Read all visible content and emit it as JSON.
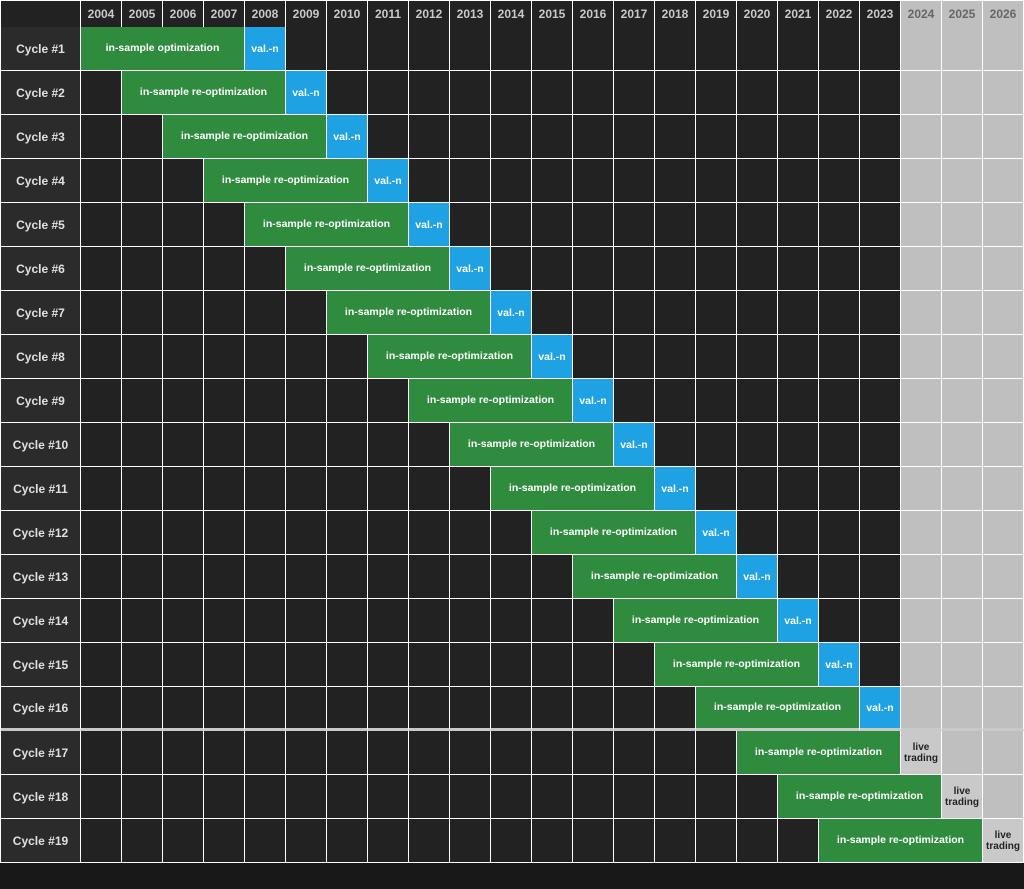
{
  "years": [
    "2004",
    "2005",
    "2006",
    "2007",
    "2008",
    "2009",
    "2010",
    "2011",
    "2012",
    "2013",
    "2014",
    "2015",
    "2016",
    "2017",
    "2018",
    "2019",
    "2020",
    "2021",
    "2022",
    "2023",
    "2024",
    "2025",
    "2026"
  ],
  "future_years_start_index": 20,
  "labels": {
    "opt_first": "in-sample optimization",
    "opt_re": "in-sample re-optimization",
    "val": "val.-n",
    "live": "live trading"
  },
  "rows": [
    {
      "name": "Cycle #1",
      "opt_start": 0,
      "opt_end": 4,
      "val": 4,
      "first": true
    },
    {
      "name": "Cycle #2",
      "opt_start": 1,
      "opt_end": 5,
      "val": 5
    },
    {
      "name": "Cycle #3",
      "opt_start": 2,
      "opt_end": 6,
      "val": 6
    },
    {
      "name": "Cycle #4",
      "opt_start": 3,
      "opt_end": 7,
      "val": 7
    },
    {
      "name": "Cycle #5",
      "opt_start": 4,
      "opt_end": 8,
      "val": 8
    },
    {
      "name": "Cycle #6",
      "opt_start": 5,
      "opt_end": 9,
      "val": 9
    },
    {
      "name": "Cycle #7",
      "opt_start": 6,
      "opt_end": 10,
      "val": 10
    },
    {
      "name": "Cycle #8",
      "opt_start": 7,
      "opt_end": 11,
      "val": 11
    },
    {
      "name": "Cycle #9",
      "opt_start": 8,
      "opt_end": 12,
      "val": 12
    },
    {
      "name": "Cycle #10",
      "opt_start": 9,
      "opt_end": 13,
      "val": 13
    },
    {
      "name": "Cycle #11",
      "opt_start": 10,
      "opt_end": 14,
      "val": 14
    },
    {
      "name": "Cycle #12",
      "opt_start": 11,
      "opt_end": 15,
      "val": 15
    },
    {
      "name": "Cycle #13",
      "opt_start": 12,
      "opt_end": 16,
      "val": 16
    },
    {
      "name": "Cycle #14",
      "opt_start": 13,
      "opt_end": 17,
      "val": 17
    },
    {
      "name": "Cycle #15",
      "opt_start": 14,
      "opt_end": 18,
      "val": 18
    },
    {
      "name": "Cycle #16",
      "opt_start": 15,
      "opt_end": 19,
      "val": 19,
      "last_val": true
    },
    {
      "name": "Cycle #17",
      "opt_start": 16,
      "opt_end": 20,
      "live": 20
    },
    {
      "name": "Cycle #18",
      "opt_start": 17,
      "opt_end": 21,
      "live": 21
    },
    {
      "name": "Cycle #19",
      "opt_start": 18,
      "opt_end": 22,
      "live": 22
    }
  ],
  "chart_data": {
    "type": "table",
    "description": "Walk-forward optimization schedule. Each cycle has a 4-year in-sample window followed by a 1-year validation (val.-n) period. Cycle 1 optimizes 2004-2007 and validates 2008, each subsequent cycle shifts by one year. Cycles 17-19 run into future years 2024-2026 and their final slot is labeled 'live trading' instead of validation.",
    "years": [
      "2004",
      "2005",
      "2006",
      "2007",
      "2008",
      "2009",
      "2010",
      "2011",
      "2012",
      "2013",
      "2014",
      "2015",
      "2016",
      "2017",
      "2018",
      "2019",
      "2020",
      "2021",
      "2022",
      "2023",
      "2024",
      "2025",
      "2026"
    ],
    "cycles": [
      {
        "cycle": 1,
        "in_sample": [
          "2004",
          "2005",
          "2006",
          "2007"
        ],
        "validation": "2008"
      },
      {
        "cycle": 2,
        "in_sample": [
          "2005",
          "2006",
          "2007",
          "2008"
        ],
        "validation": "2009"
      },
      {
        "cycle": 3,
        "in_sample": [
          "2006",
          "2007",
          "2008",
          "2009"
        ],
        "validation": "2010"
      },
      {
        "cycle": 4,
        "in_sample": [
          "2007",
          "2008",
          "2009",
          "2010"
        ],
        "validation": "2011"
      },
      {
        "cycle": 5,
        "in_sample": [
          "2008",
          "2009",
          "2010",
          "2011"
        ],
        "validation": "2012"
      },
      {
        "cycle": 6,
        "in_sample": [
          "2009",
          "2010",
          "2011",
          "2012"
        ],
        "validation": "2013"
      },
      {
        "cycle": 7,
        "in_sample": [
          "2010",
          "2011",
          "2012",
          "2013"
        ],
        "validation": "2014"
      },
      {
        "cycle": 8,
        "in_sample": [
          "2011",
          "2012",
          "2013",
          "2014"
        ],
        "validation": "2015"
      },
      {
        "cycle": 9,
        "in_sample": [
          "2012",
          "2013",
          "2014",
          "2015"
        ],
        "validation": "2016"
      },
      {
        "cycle": 10,
        "in_sample": [
          "2013",
          "2014",
          "2015",
          "2016"
        ],
        "validation": "2017"
      },
      {
        "cycle": 11,
        "in_sample": [
          "2014",
          "2015",
          "2016",
          "2017"
        ],
        "validation": "2018"
      },
      {
        "cycle": 12,
        "in_sample": [
          "2015",
          "2016",
          "2017",
          "2018"
        ],
        "validation": "2019"
      },
      {
        "cycle": 13,
        "in_sample": [
          "2016",
          "2017",
          "2018",
          "2019"
        ],
        "validation": "2020"
      },
      {
        "cycle": 14,
        "in_sample": [
          "2017",
          "2018",
          "2019",
          "2020"
        ],
        "validation": "2021"
      },
      {
        "cycle": 15,
        "in_sample": [
          "2018",
          "2019",
          "2020",
          "2021"
        ],
        "validation": "2022"
      },
      {
        "cycle": 16,
        "in_sample": [
          "2019",
          "2020",
          "2021",
          "2022"
        ],
        "validation": "2023"
      },
      {
        "cycle": 17,
        "in_sample": [
          "2020",
          "2021",
          "2022",
          "2023"
        ],
        "live_trading": "2024"
      },
      {
        "cycle": 18,
        "in_sample": [
          "2021",
          "2022",
          "2023",
          "2024"
        ],
        "live_trading": "2025"
      },
      {
        "cycle": 19,
        "in_sample": [
          "2022",
          "2023",
          "2024",
          "2025"
        ],
        "live_trading": "2026"
      }
    ]
  }
}
